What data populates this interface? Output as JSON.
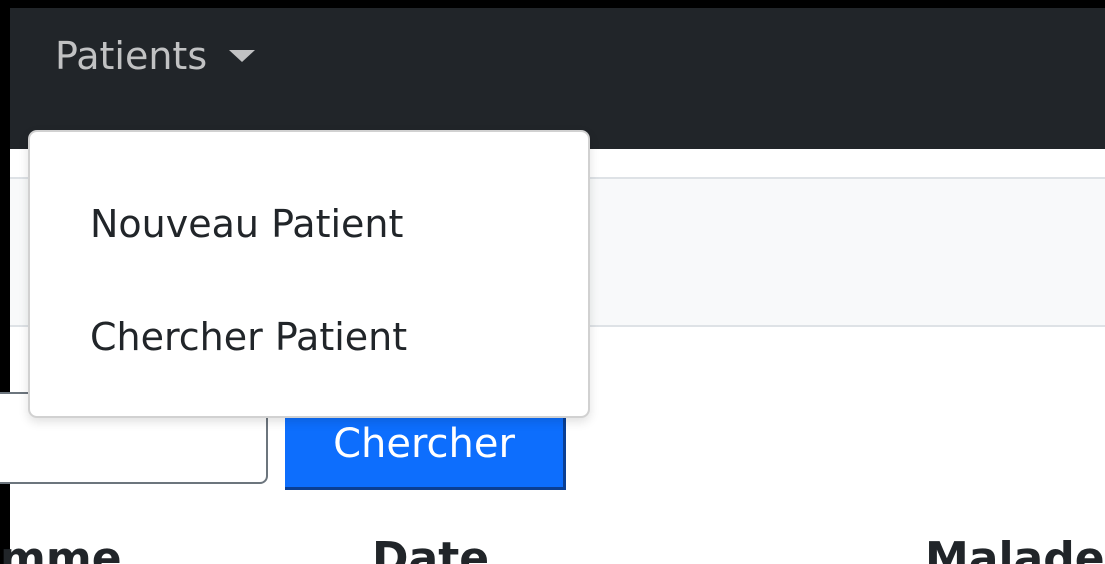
{
  "navbar": {
    "dropdown_label": "Patients",
    "caret_icon": "caret-down-icon",
    "background": "#212529"
  },
  "dropdown": {
    "items": [
      {
        "label": "Nouveau Patient"
      },
      {
        "label": "Chercher Patient"
      }
    ]
  },
  "search": {
    "input_value": "",
    "button_label": "Chercher",
    "button_color": "#0d6efd"
  },
  "table": {
    "headers": [
      "mme",
      "Date",
      "Malade"
    ]
  }
}
